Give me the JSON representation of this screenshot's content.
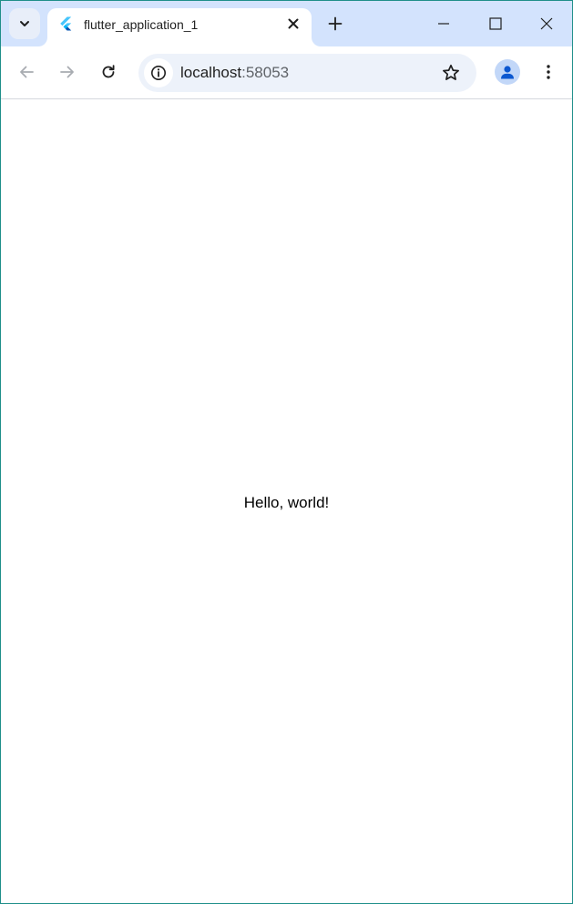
{
  "browser": {
    "tab": {
      "title": "flutter_application_1",
      "favicon": "flutter-logo-icon"
    },
    "tab_strip_icons": {
      "search_tabs": "chevron-down-icon",
      "new_tab": "plus-icon",
      "close_tab": "close-icon",
      "minimize": "minimize-icon",
      "maximize": "maximize-icon",
      "close_window": "close-icon"
    },
    "toolbar_icons": {
      "back": "arrow-left-icon",
      "forward": "arrow-right-icon",
      "reload": "reload-icon",
      "site_info": "info-icon",
      "bookmark": "star-icon",
      "profile": "person-icon",
      "menu": "more-vert-icon"
    },
    "address": {
      "host": "localhost",
      "port": ":58053"
    }
  },
  "page": {
    "body_text": "Hello, world!"
  },
  "colors": {
    "tabstrip_bg": "#d3e3fd",
    "omnibox_bg": "#edf2fa",
    "window_border": "#1f8f8a",
    "flutter_light_blue": "#47c5fb",
    "flutter_dark_blue": "#0553b1",
    "profile_accent": "#0b57d0"
  }
}
